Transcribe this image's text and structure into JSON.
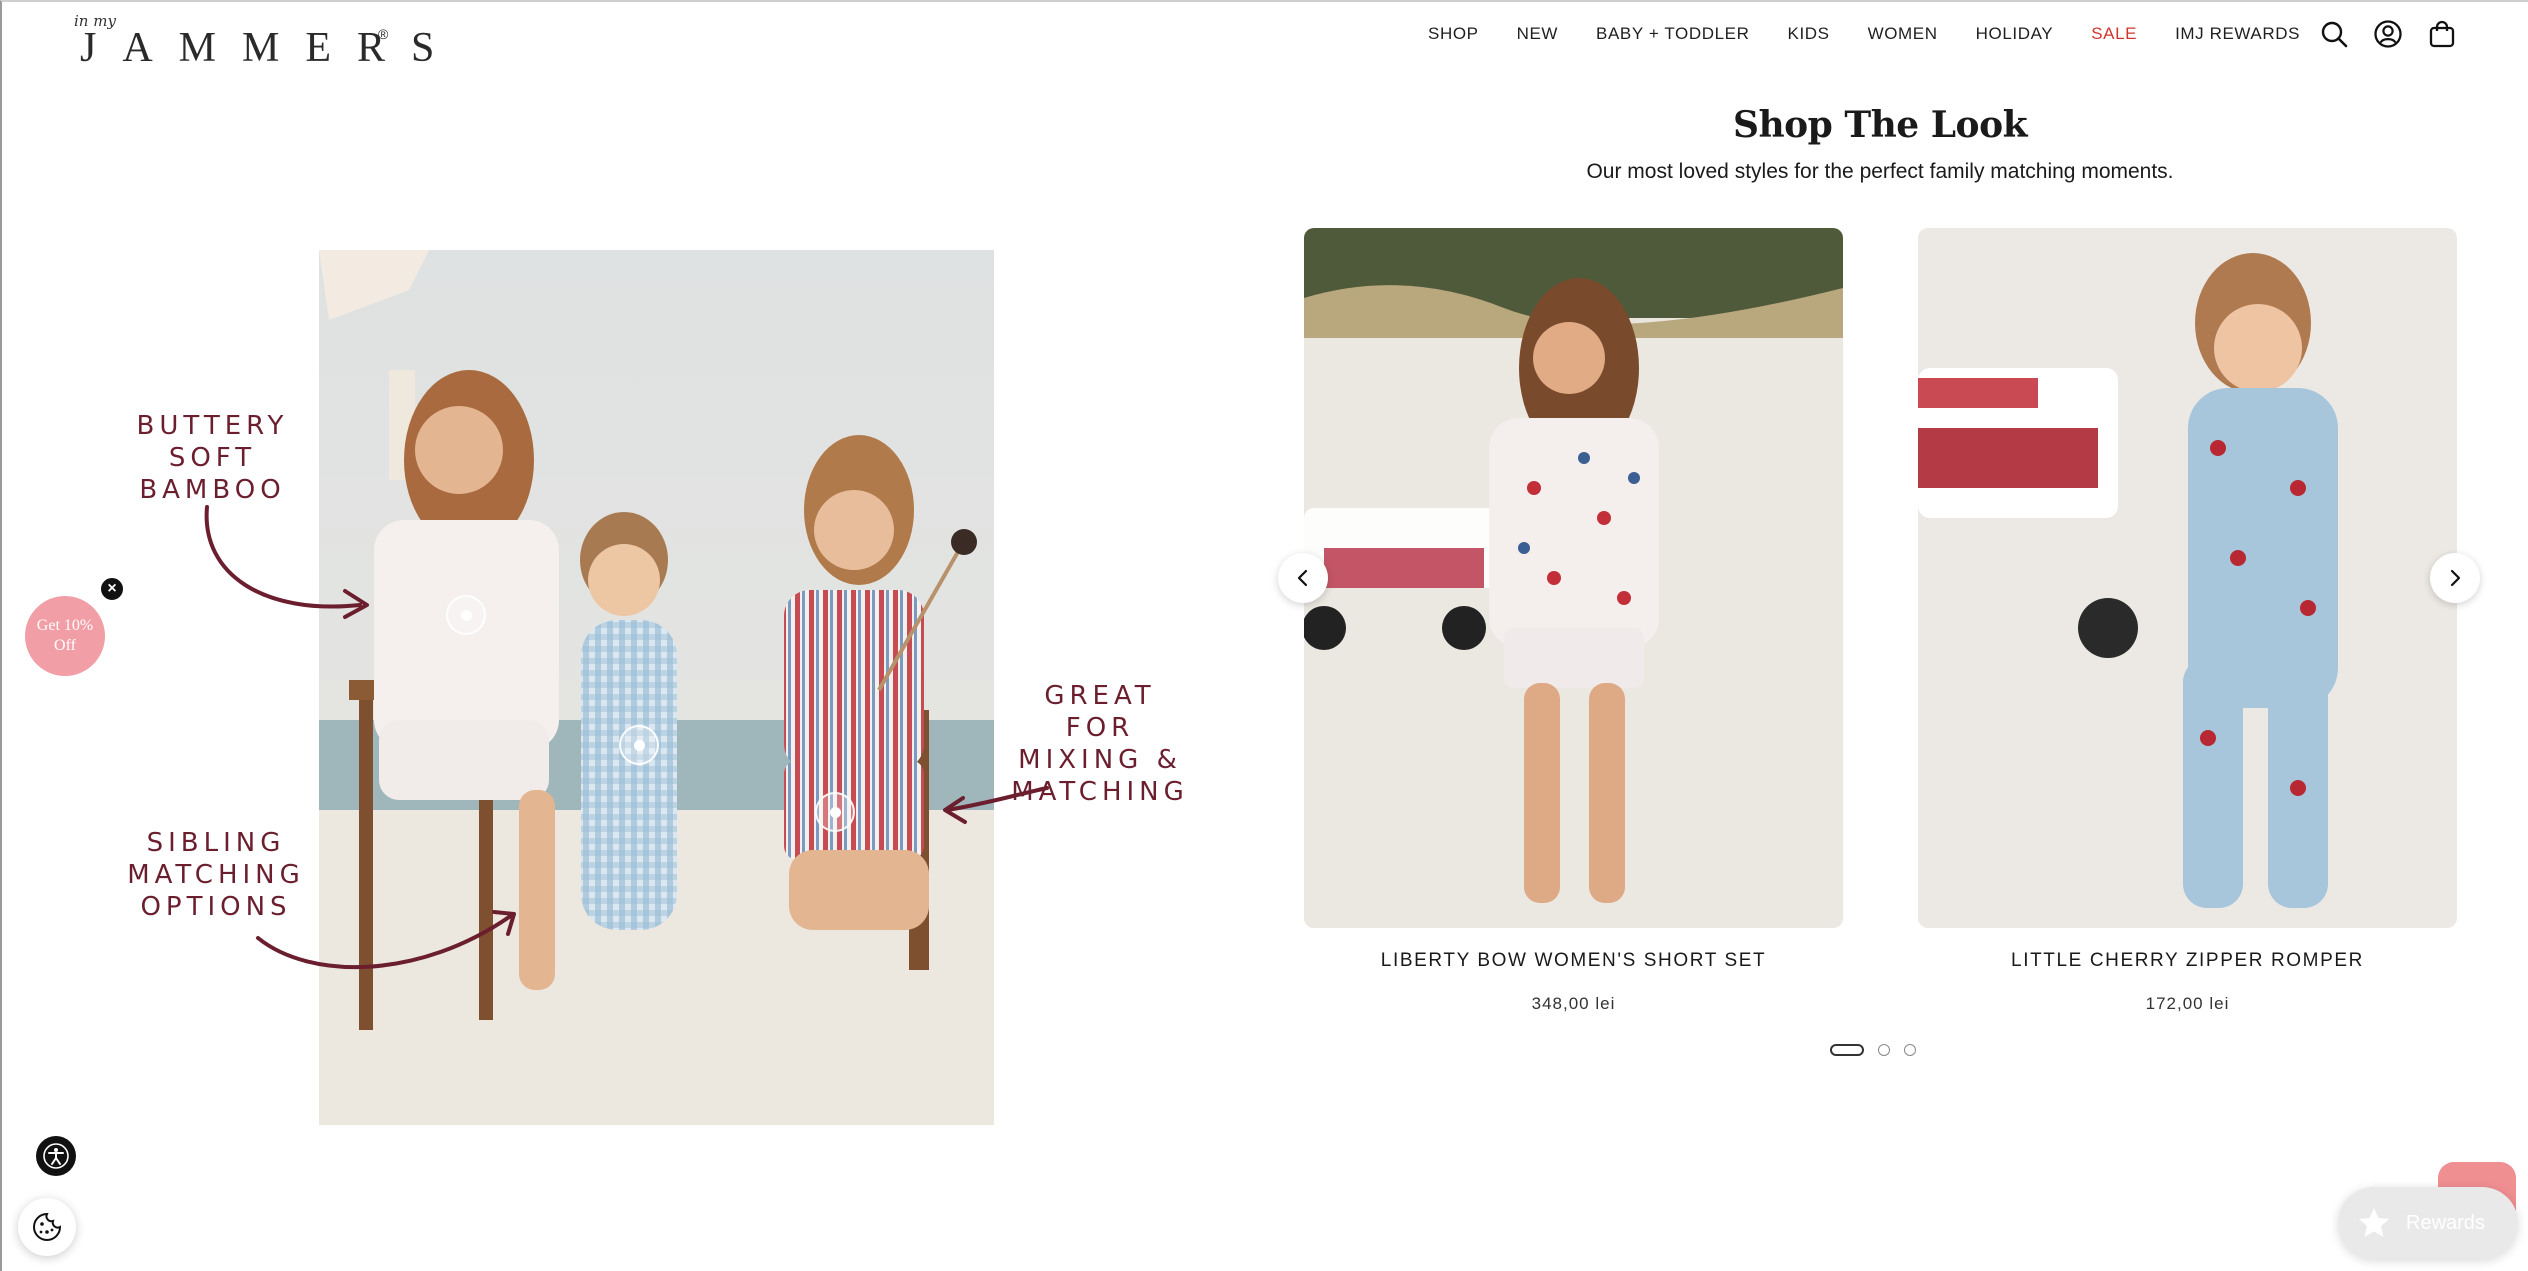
{
  "header": {
    "logo_small": "in my",
    "logo_word": "JAMMERS",
    "logo_reg": "®",
    "nav": [
      {
        "label": "SHOP"
      },
      {
        "label": "NEW"
      },
      {
        "label": "BABY + TODDLER"
      },
      {
        "label": "KIDS"
      },
      {
        "label": "WOMEN"
      },
      {
        "label": "HOLIDAY"
      },
      {
        "label": "SALE"
      },
      {
        "label": "IMJ REWARDS"
      }
    ],
    "icons": [
      "search-icon",
      "account-icon",
      "cart-icon"
    ]
  },
  "look": {
    "callouts": [
      {
        "text": "BUTTERY\nSOFT\nBAMBOO"
      },
      {
        "text": "SIBLING\nMATCHING\nOPTIONS"
      },
      {
        "text": "GREAT FOR\nMIXING &\nMATCHING"
      }
    ],
    "hotspot_count": 3,
    "accent_color": "#6b1f2e"
  },
  "promo": {
    "label_line1": "Get 10%",
    "label_line2": "Off",
    "close_symbol": "×",
    "color": "#f19ea6"
  },
  "section": {
    "title": "Shop The Look",
    "subtitle": "Our most loved styles for the perfect family matching moments."
  },
  "products": [
    {
      "name": "LIBERTY BOW WOMEN'S SHORT SET",
      "price": "348,00 lei"
    },
    {
      "name": "LITTLE CHERRY ZIPPER ROMPER",
      "price": "172,00 lei"
    }
  ],
  "carousel": {
    "prev_icon": "chevron-left-icon",
    "next_icon": "chevron-right-icon",
    "pages": 3,
    "active_page": 1
  },
  "widgets": {
    "accessibility_icon": "accessibility-icon",
    "cookie_icon": "cookie-icon",
    "rewards_label": "Rewards",
    "rewards_icon": "star-icon"
  }
}
